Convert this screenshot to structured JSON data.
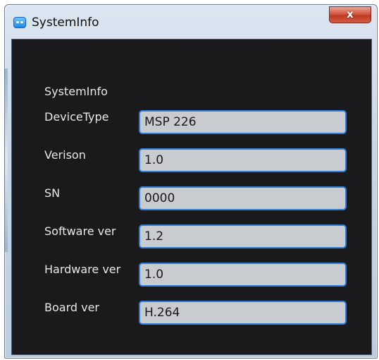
{
  "window": {
    "title": "SystemInfo",
    "close_label": "x"
  },
  "panel": {
    "heading": "SystemInfo",
    "rows": [
      {
        "label": "DeviceType",
        "value": "MSP 226"
      },
      {
        "label": "Verison",
        "value": "1.0"
      },
      {
        "label": "SN",
        "value": "0000"
      },
      {
        "label": "Software ver",
        "value": "1.2"
      },
      {
        "label": "Hardware ver",
        "value": "1.0"
      },
      {
        "label": "Board ver",
        "value": "H.264"
      }
    ]
  },
  "colors": {
    "panel_background": "#1a1a1c",
    "field_border": "#2f7fd8",
    "field_background": "#c8cbcf",
    "close_button": "#c03a22"
  },
  "icons": {
    "app_icon": "app-icon",
    "close_icon": "close-icon"
  }
}
